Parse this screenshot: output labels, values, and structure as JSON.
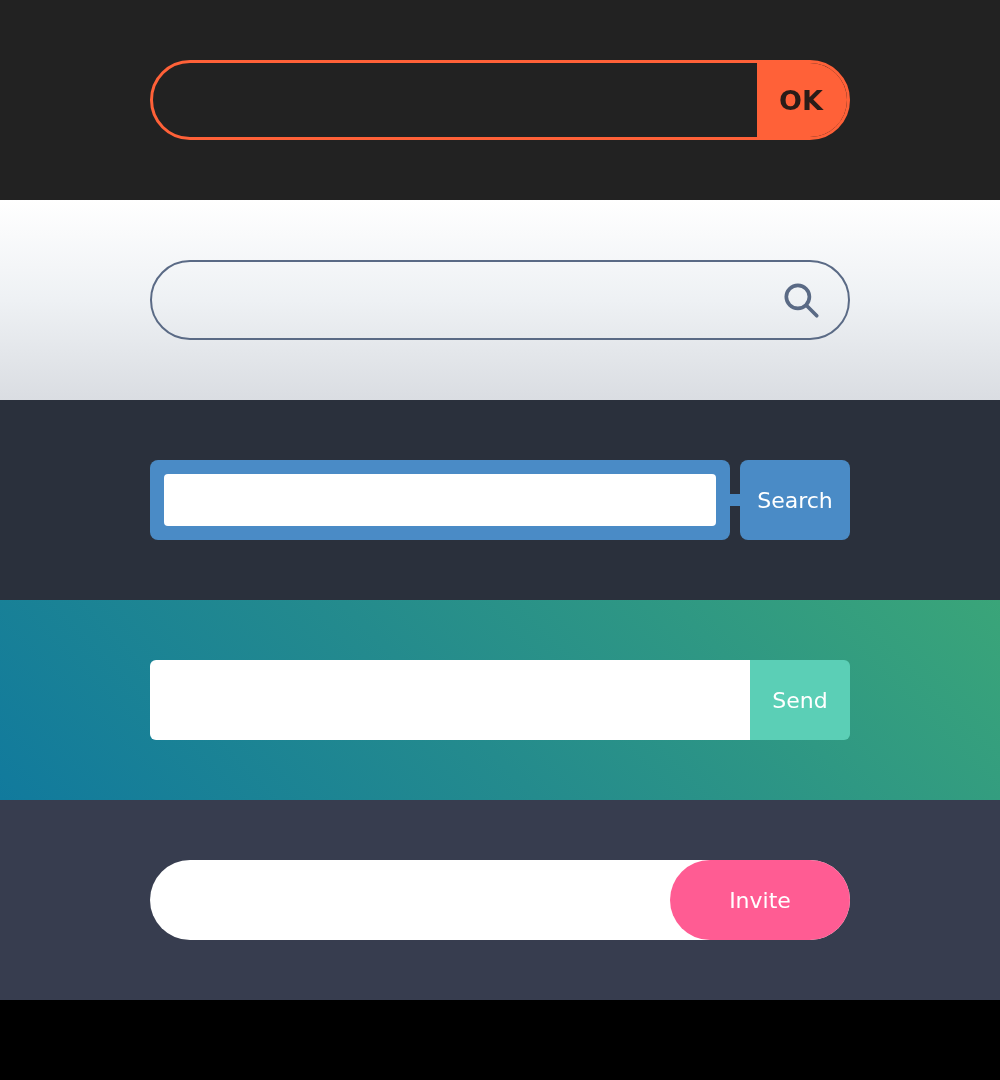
{
  "panels": [
    {
      "kind": "ok",
      "button": "OK"
    },
    {
      "kind": "search-icon"
    },
    {
      "kind": "blue",
      "button": "Search"
    },
    {
      "kind": "send",
      "button": "Send"
    },
    {
      "kind": "invite",
      "button": "Invite"
    }
  ]
}
